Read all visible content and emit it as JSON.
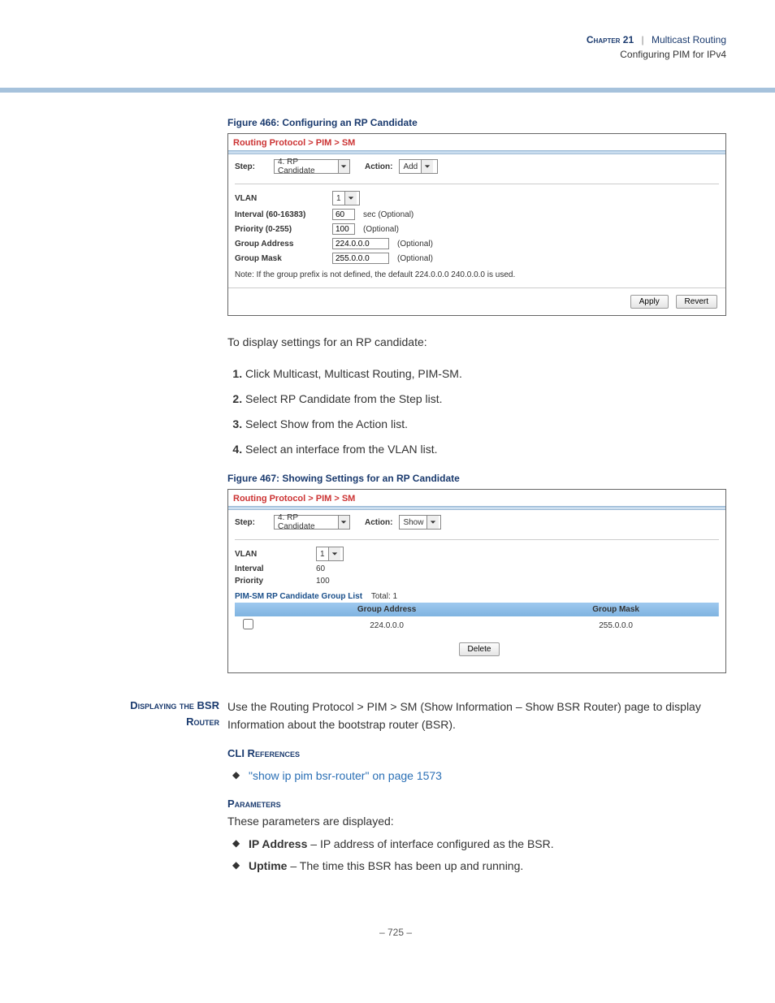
{
  "header": {
    "chapter_label": "Chapter 21",
    "separator": "|",
    "chapter_title": "Multicast Routing",
    "subtitle": "Configuring PIM for IPv4"
  },
  "fig466": {
    "caption": "Figure 466:  Configuring an RP Candidate",
    "breadcrumb": "Routing Protocol > PIM > SM",
    "step_label": "Step:",
    "step_value": "4. RP Candidate",
    "action_label": "Action:",
    "action_value": "Add",
    "vlan_label": "VLAN",
    "vlan_value": "1",
    "interval_label": "Interval (60-16383)",
    "interval_value": "60",
    "interval_unit": "sec (Optional)",
    "priority_label": "Priority (0-255)",
    "priority_value": "100",
    "priority_unit": "(Optional)",
    "groupaddr_label": "Group Address",
    "groupaddr_value": "224.0.0.0",
    "groupaddr_unit": "(Optional)",
    "groupmask_label": "Group Mask",
    "groupmask_value": "255.0.0.0",
    "groupmask_unit": "(Optional)",
    "note": "Note: If the group prefix is not defined, the default 224.0.0.0 240.0.0.0 is used.",
    "apply": "Apply",
    "revert": "Revert"
  },
  "intro_text": "To display settings for an RP candidate:",
  "steps": {
    "s1": "Click Multicast, Multicast Routing, PIM-SM.",
    "s2": "Select RP Candidate from the Step list.",
    "s3": "Select Show from the Action list.",
    "s4": "Select an interface from the VLAN list."
  },
  "fig467": {
    "caption": "Figure 467:  Showing Settings for an RP Candidate",
    "breadcrumb": "Routing Protocol > PIM > SM",
    "step_label": "Step:",
    "step_value": "4. RP Candidate",
    "action_label": "Action:",
    "action_value": "Show",
    "vlan_label": "VLAN",
    "vlan_value": "1",
    "interval_label": "Interval",
    "interval_value": "60",
    "priority_label": "Priority",
    "priority_value": "100",
    "list_title": "PIM-SM RP Candidate Group List",
    "list_total_label": "Total: 1",
    "col_groupaddr": "Group Address",
    "col_groupmask": "Group Mask",
    "row1_addr": "224.0.0.0",
    "row1_mask": "255.0.0.0",
    "delete": "Delete"
  },
  "bsr": {
    "title_l1": "Displaying the BSR",
    "title_l2": "Router",
    "body": "Use the Routing Protocol > PIM > SM (Show Information – Show BSR Router) page to display Information about the bootstrap router (BSR).",
    "cli_heading": "CLI References",
    "cli_link": "\"show ip pim bsr-router\" on page 1573",
    "params_heading": "Parameters",
    "params_intro": "These parameters are displayed:",
    "p1_name": "IP Address",
    "p1_desc": " – IP address of interface configured as the BSR.",
    "p2_name": "Uptime",
    "p2_desc": " – The time this BSR has been up and running."
  },
  "footer": {
    "page": "–  725  –"
  }
}
